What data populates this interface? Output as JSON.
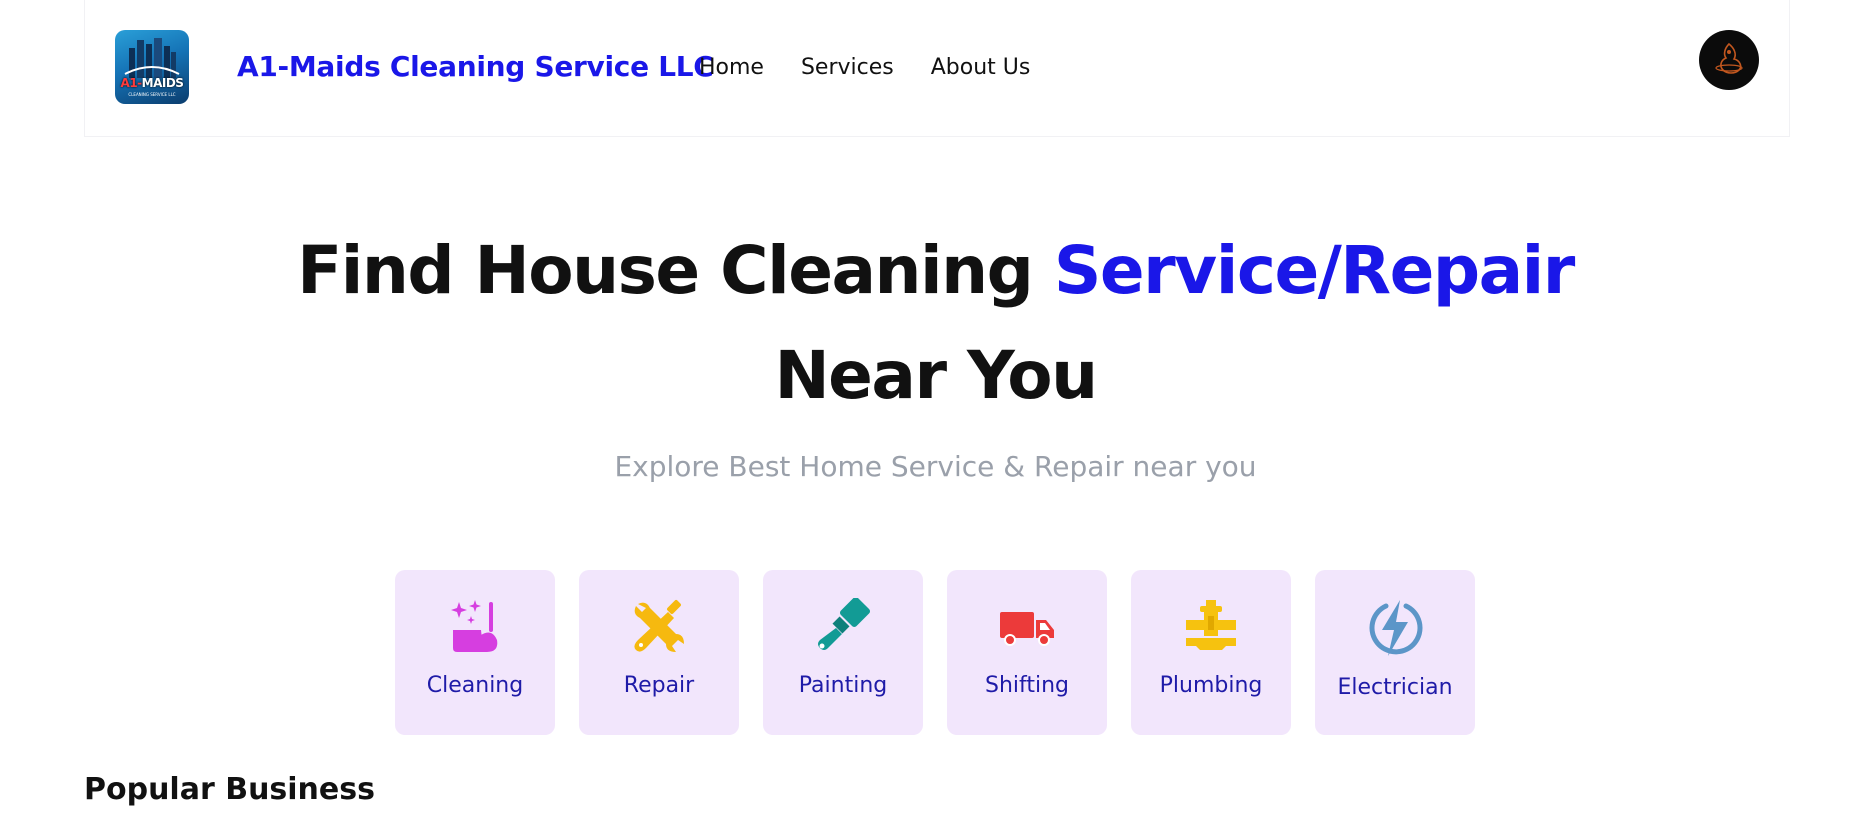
{
  "header": {
    "logo": {
      "word_red": "A1-",
      "word_white": "MAIDS",
      "sub": "CLEANING SERVICE LLC",
      "bg": "#1573b6"
    },
    "brand": "A1-Maids Cleaning Service LLC",
    "nav": [
      {
        "label": "Home"
      },
      {
        "label": "Services"
      },
      {
        "label": "About Us"
      }
    ],
    "avatar": {
      "icon": "user-avatar"
    }
  },
  "hero": {
    "title_part1": "Find House Cleaning ",
    "title_accent": "Service/Repair",
    "title_line2": "Near You",
    "subtitle": "Explore Best Home Service & Repair near you"
  },
  "categories": [
    {
      "label": "Cleaning",
      "icon": "cleaning-icon",
      "color": "#d63ee0"
    },
    {
      "label": "Repair",
      "icon": "tools-icon",
      "color": "#f6b90f"
    },
    {
      "label": "Painting",
      "icon": "paintbrush-icon",
      "color": "#129b95"
    },
    {
      "label": "Shifting",
      "icon": "truck-icon",
      "color": "#ec3a3a"
    },
    {
      "label": "Plumbing",
      "icon": "pipe-wrench-icon",
      "color": "#f6c20f"
    },
    {
      "label": "Electrician",
      "icon": "lightning-icon",
      "color": "#5c96c8"
    }
  ],
  "sections": {
    "popular_title": "Popular Business"
  },
  "colors": {
    "accent": "#1a17e8",
    "card_bg": "#f2e6fc",
    "card_text": "#1f1ba8",
    "muted": "#9aa0aa"
  }
}
